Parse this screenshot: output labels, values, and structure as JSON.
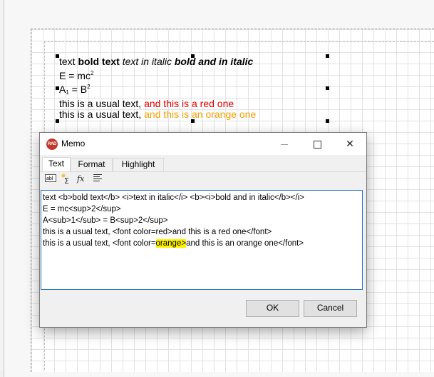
{
  "preview": {
    "line1": {
      "plain": "text ",
      "bold": "bold text",
      "space1": " ",
      "italic": "text in italic",
      "space2": " ",
      "bold_italic": "bold and in italic"
    },
    "line2": {
      "base": "E = mc",
      "sup": "2"
    },
    "line3": {
      "a": "A",
      "sub": "1",
      "eq": " = B",
      "sup": "2"
    },
    "line4": {
      "plain": "this is a usual text, ",
      "colored": "and this is a red one"
    },
    "line5": {
      "plain": "this is a usual text, ",
      "colored": "and this is an orange one"
    }
  },
  "dialog": {
    "icon_text": "RAD",
    "title": "Memo",
    "tabs": [
      "Text",
      "Format",
      "Highlight"
    ],
    "toolbar_icons": [
      "text-field-icon",
      "sum-icon",
      "function-icon",
      "align-icon"
    ],
    "editor_lines": [
      "text <b>bold text</b> <i>text in italic</i> <b><i>bold and in italic</b></i>",
      "E = mc<sup>2</sup>",
      "A<sub>1</sub> = B<sup>2</sup>",
      "this is a usual text, <font color=red>and this is a red one</font>"
    ],
    "editor_line5": {
      "before": "this is a usual text, <font color=",
      "highlighted": "orange>",
      "after": "and this is an orange one</font>"
    },
    "ok_label": "OK",
    "cancel_label": "Cancel"
  },
  "colors": {
    "red": "#e00000",
    "orange": "#f0a000",
    "highlight": "#fff200",
    "editor_border": "#2a73b8"
  }
}
